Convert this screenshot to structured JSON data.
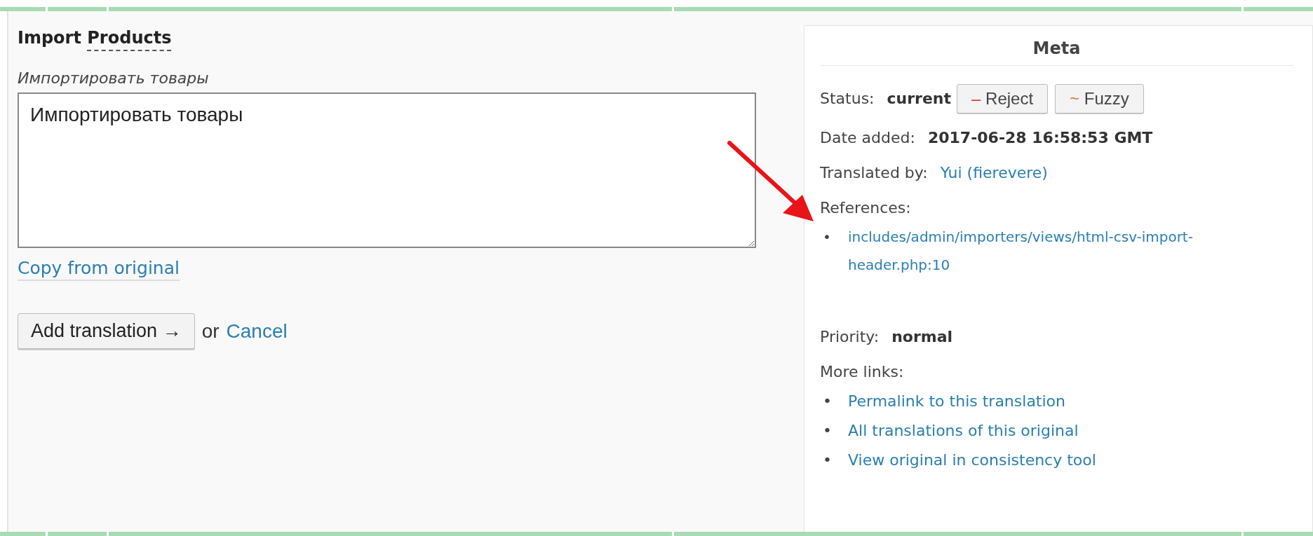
{
  "editor": {
    "original_parts": [
      {
        "text": "Import ",
        "glossary": false
      },
      {
        "text": "Products",
        "glossary": true
      }
    ],
    "hint": "Импортировать товары",
    "translation_field": {
      "value": "Импортировать товары"
    },
    "copy_link": "Copy from original",
    "submit_button": "Add translation →",
    "or_text": "or",
    "cancel_link": "Cancel"
  },
  "meta": {
    "title": "Meta",
    "status": {
      "label": "Status:",
      "value": "current"
    },
    "actions": [
      {
        "kind": "reject",
        "symbol": "–",
        "label": "Reject"
      },
      {
        "kind": "fuzzy",
        "symbol": "~",
        "label": "Fuzzy"
      }
    ],
    "date_added": {
      "label": "Date added:",
      "value": "2017-06-28 16:58:53 GMT"
    },
    "translated_by": {
      "label": "Translated by:",
      "value": "Yui (fierevere)"
    },
    "references": {
      "label": "References:",
      "links": [
        {
          "marker": "•",
          "text": "includes/admin/importers/views/html-csv-import-header.php:10"
        }
      ]
    },
    "priority": {
      "label": "Priority:",
      "value": "normal"
    },
    "more_links": {
      "label": "More links:",
      "links": [
        {
          "marker": "•",
          "text": "Permalink to this translation"
        },
        {
          "marker": "•",
          "text": "All translations of this original"
        },
        {
          "marker": "•",
          "text": "View original in consistency tool"
        }
      ]
    }
  }
}
